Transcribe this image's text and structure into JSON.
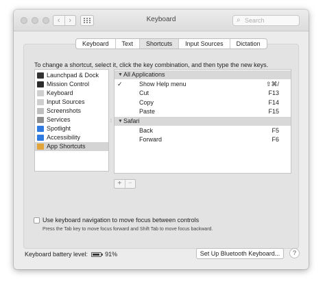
{
  "window": {
    "title": "Keyboard",
    "search_placeholder": "Search",
    "nav_back": "‹",
    "nav_forward": "›"
  },
  "tabs": [
    {
      "label": "Keyboard",
      "active": false
    },
    {
      "label": "Text",
      "active": false
    },
    {
      "label": "Shortcuts",
      "active": true
    },
    {
      "label": "Input Sources",
      "active": false
    },
    {
      "label": "Dictation",
      "active": false
    }
  ],
  "instructions": "To change a shortcut, select it, click the key combination, and then type the new keys.",
  "categories": [
    {
      "label": "Launchpad & Dock",
      "icon": "launchpad-dock-icon",
      "color": "#333333",
      "selected": false
    },
    {
      "label": "Mission Control",
      "icon": "mission-control-icon",
      "color": "#2b2b2b",
      "selected": false
    },
    {
      "label": "Keyboard",
      "icon": "keyboard-icon",
      "color": "#cfcfcf",
      "selected": false
    },
    {
      "label": "Input Sources",
      "icon": "input-sources-icon",
      "color": "#cfcfcf",
      "selected": false
    },
    {
      "label": "Screenshots",
      "icon": "screenshots-icon",
      "color": "#bfbfbf",
      "selected": false
    },
    {
      "label": "Services",
      "icon": "gear-icon",
      "color": "#8e8e8e",
      "selected": false
    },
    {
      "label": "Spotlight",
      "icon": "spotlight-icon",
      "color": "#2f7be0",
      "selected": false
    },
    {
      "label": "Accessibility",
      "icon": "accessibility-icon",
      "color": "#2f7be0",
      "selected": false
    },
    {
      "label": "App Shortcuts",
      "icon": "app-shortcuts-icon",
      "color": "#e0a43a",
      "selected": true
    }
  ],
  "shortcuts": [
    {
      "type": "group",
      "label": "All Applications"
    },
    {
      "type": "item",
      "checked": true,
      "name": "Show Help menu",
      "key": "⇧⌘/"
    },
    {
      "type": "item",
      "checked": false,
      "name": "Cut",
      "key": "F13"
    },
    {
      "type": "item",
      "checked": false,
      "name": "Copy",
      "key": "F14"
    },
    {
      "type": "item",
      "checked": false,
      "name": "Paste",
      "key": "F15"
    },
    {
      "type": "group",
      "label": "Safari"
    },
    {
      "type": "item",
      "checked": false,
      "name": "Back",
      "key": "F5"
    },
    {
      "type": "item",
      "checked": false,
      "name": "Forward",
      "key": "F6"
    }
  ],
  "add_label": "+",
  "remove_label": "−",
  "keyboard_navigation": {
    "label": "Use keyboard navigation to move focus between controls",
    "checked": false,
    "description": "Press the Tab key to move focus forward and Shift Tab to move focus backward."
  },
  "battery": {
    "label": "Keyboard battery level:",
    "value": "91%",
    "level": 0.91
  },
  "bluetooth_button": "Set Up Bluetooth Keyboard...",
  "help_label": "?"
}
